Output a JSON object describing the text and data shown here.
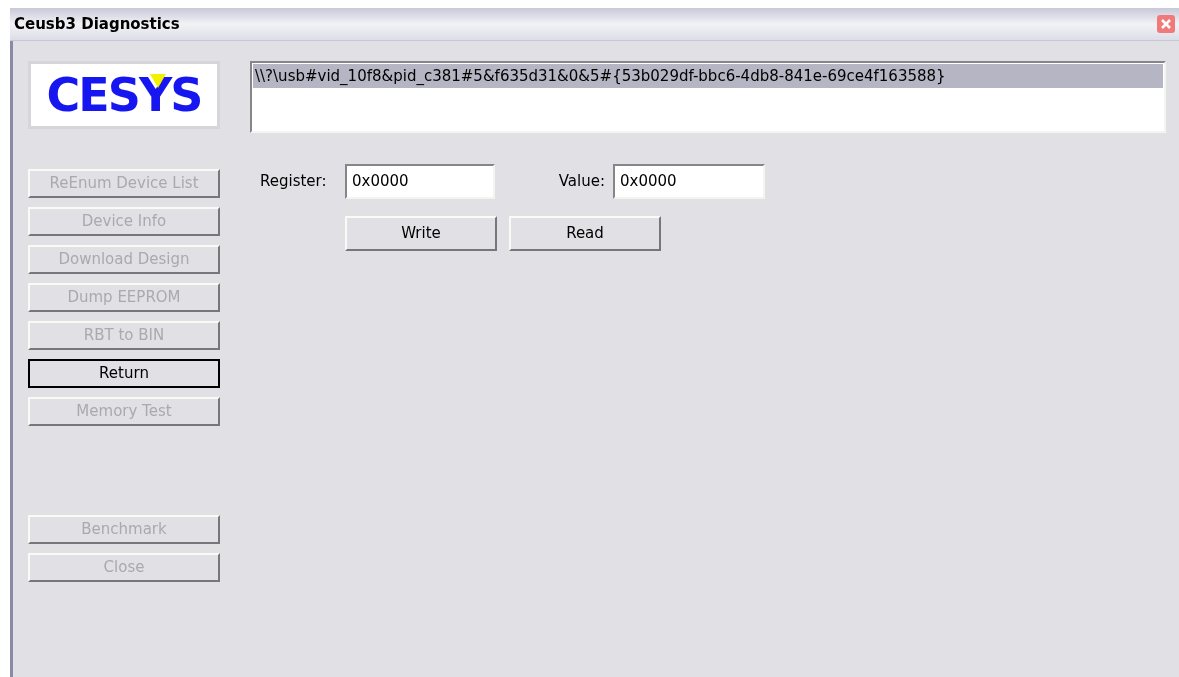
{
  "window": {
    "title": "Ceusb3 Diagnostics"
  },
  "logo": {
    "text": "CESYS"
  },
  "device_list": {
    "items": [
      {
        "text": "\\\\?\\usb#vid_10f8&pid_c381#5&f635d31&0&5#{53b029df-bbc6-4db8-841e-69ce4f163588}",
        "selected": true
      }
    ]
  },
  "side_buttons": [
    {
      "label": "ReEnum Device List",
      "disabled": true,
      "default": false,
      "gap_before": false
    },
    {
      "label": "Device Info",
      "disabled": true,
      "default": false,
      "gap_before": false
    },
    {
      "label": "Download Design",
      "disabled": true,
      "default": false,
      "gap_before": false
    },
    {
      "label": "Dump EEPROM",
      "disabled": true,
      "default": false,
      "gap_before": false
    },
    {
      "label": "RBT to BIN",
      "disabled": true,
      "default": false,
      "gap_before": false
    },
    {
      "label": "Return",
      "disabled": false,
      "default": true,
      "gap_before": false
    },
    {
      "label": "Memory Test",
      "disabled": true,
      "default": false,
      "gap_before": false
    },
    {
      "label": "Benchmark",
      "disabled": true,
      "default": false,
      "gap_before": true
    },
    {
      "label": "Close",
      "disabled": true,
      "default": false,
      "gap_before": false
    }
  ],
  "register": {
    "label": "Register:",
    "value": "0x0000"
  },
  "value": {
    "label": "Value:",
    "value": "0x0000"
  },
  "actions": [
    {
      "label": "Write"
    },
    {
      "label": "Read"
    }
  ]
}
